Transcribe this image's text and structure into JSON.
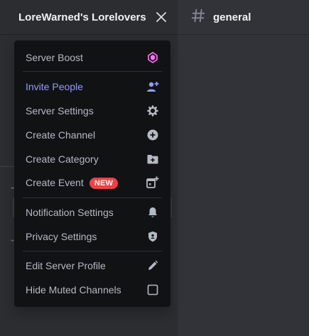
{
  "server": {
    "name": "LoreWarned's Lorelovers"
  },
  "channel": {
    "name": "general"
  },
  "menu": {
    "items": [
      {
        "label": "Server Boost",
        "icon": "boost-gem-icon"
      },
      {
        "label": "Invite People",
        "icon": "add-person-icon"
      },
      {
        "label": "Server Settings",
        "icon": "gear-icon"
      },
      {
        "label": "Create Channel",
        "icon": "plus-circle-icon"
      },
      {
        "label": "Create Category",
        "icon": "folder-plus-icon"
      },
      {
        "label": "Create Event",
        "badge": "NEW",
        "icon": "calendar-plus-icon"
      },
      {
        "label": "Notification Settings",
        "icon": "bell-icon"
      },
      {
        "label": "Privacy Settings",
        "icon": "shield-icon"
      },
      {
        "label": "Edit Server Profile",
        "icon": "pencil-icon"
      },
      {
        "label": "Hide Muted Channels",
        "icon": "checkbox-icon",
        "checked": false
      }
    ]
  },
  "colors": {
    "menu_bg": "#111214",
    "invite_accent": "#949cf7",
    "boost_pink": "#ff73fa",
    "badge_red": "#f23f43"
  }
}
